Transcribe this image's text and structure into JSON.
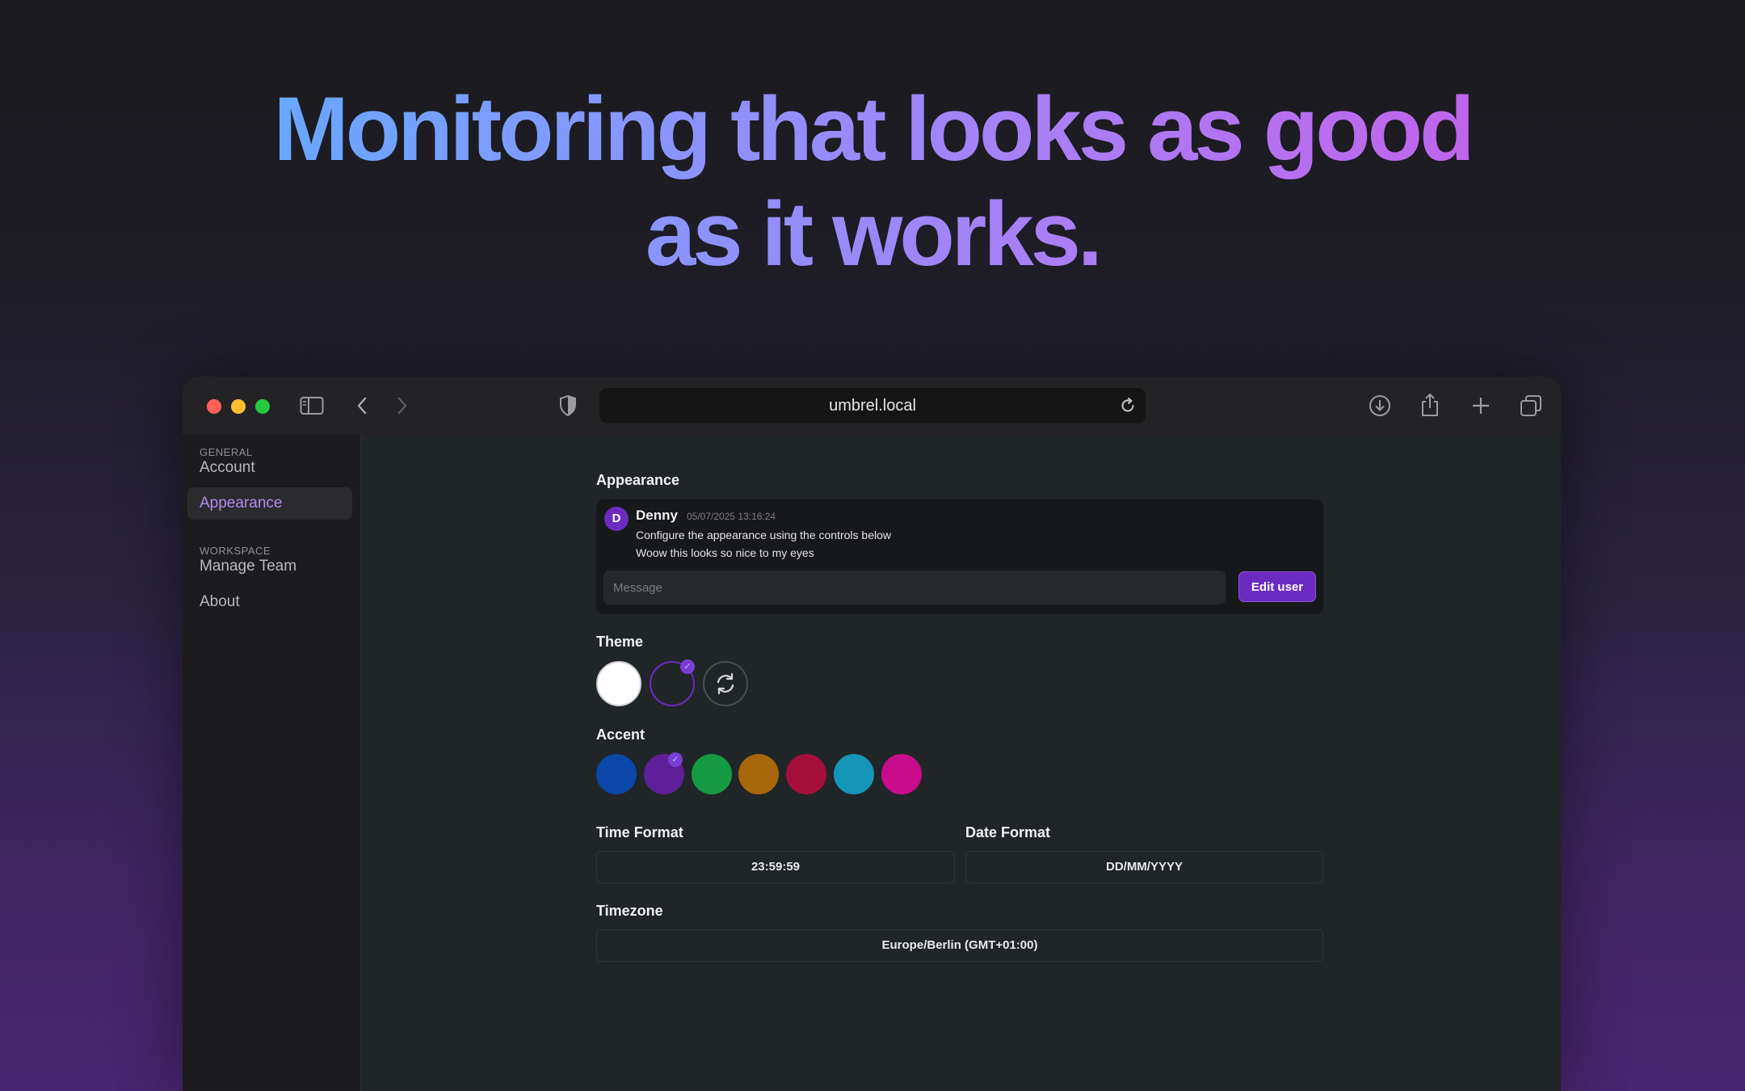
{
  "hero": {
    "line1": "Monitoring that looks as good",
    "line2": "as it works."
  },
  "browser": {
    "url": "umbrel.local",
    "traffic_colors": [
      "#ff5f57",
      "#febc2e",
      "#28c840"
    ]
  },
  "sidebar": {
    "sections": [
      {
        "label": "GENERAL",
        "items": [
          {
            "label": "Account",
            "active": false
          },
          {
            "label": "Appearance",
            "active": true
          }
        ]
      },
      {
        "label": "WORKSPACE",
        "items": [
          {
            "label": "Manage Team",
            "active": false
          },
          {
            "label": "About",
            "active": false
          }
        ]
      }
    ]
  },
  "appearance": {
    "title": "Appearance",
    "preview": {
      "avatar_letter": "D",
      "author": "Denny",
      "timestamp": "05/07/2025 13:16:24",
      "lines": [
        "Configure the appearance using the controls below",
        "Woow this looks so nice to my eyes"
      ],
      "input_placeholder": "Message",
      "button_label": "Edit user"
    }
  },
  "theme": {
    "title": "Theme",
    "options": [
      "light",
      "dark",
      "auto"
    ],
    "selected": "dark"
  },
  "accent": {
    "title": "Accent",
    "colors": [
      "#0a47a8",
      "#6b1fb0",
      "#139a43",
      "#a8670a",
      "#a60f3c",
      "#1595b8",
      "#c80c8c"
    ],
    "selected_index": 1
  },
  "time_format": {
    "title": "Time Format",
    "value": "23:59:59"
  },
  "date_format": {
    "title": "Date Format",
    "value": "DD/MM/YYYY"
  },
  "timezone": {
    "title": "Timezone",
    "value": "Europe/Berlin (GMT+01:00)"
  }
}
